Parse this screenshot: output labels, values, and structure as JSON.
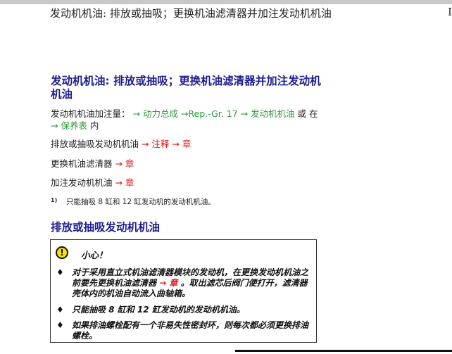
{
  "header": {
    "running_title": "发动机机油: 排放或抽吸；更换机油滤清器并加注发动机机油",
    "edge_char": "I"
  },
  "section": {
    "title": "发动机机油: 排放或抽吸；更换机油滤清器并加注发动机机油",
    "fill_quantity": {
      "prefix": "发动机机油加注量：",
      "link1": "→ 动力总成 →Rep.-Gr. 17 → 发动机机油",
      "mid": " 或 在 ",
      "link2": "→ 保养表",
      "suffix": " 内"
    },
    "drain_line": {
      "text": "排放或抽吸发动机机油 ",
      "link": "→ 注释 → 章"
    },
    "filter_line": {
      "text": "更换机油滤清器 ",
      "link": "→ 章"
    },
    "fill_line": {
      "text": "加注发动机机油 ",
      "link": "→ 章"
    },
    "footnote": {
      "mark": "1)",
      "text": "只能抽吸 8 缸和 12 缸发动机的发动机机油。"
    }
  },
  "subsection": {
    "title": "排放或抽吸发动机机油",
    "caution": {
      "icon": "!",
      "title": "小心！",
      "bullets": [
        {
          "before": "对于采用直立式机油滤清器模块的发动机，在更换发动机机油之前要先更换机油滤清器 ",
          "link": "→ 章",
          "after": " 。取出滤芯后阀门便打开，滤清器壳体内的机油自动流入曲轴箱。"
        },
        {
          "text": "只能抽吸 8 缸和 12 缸发动机的发动机机油。"
        },
        {
          "text": "如果排油螺栓配有一个非易失性密封环，则每次都必须更换排油螺栓。"
        }
      ]
    }
  },
  "colors": {
    "heading": "#1d1d8f",
    "link_green": "#2e9b3a",
    "link_red": "#e01a1a",
    "warning_yellow": "#f5e100"
  }
}
